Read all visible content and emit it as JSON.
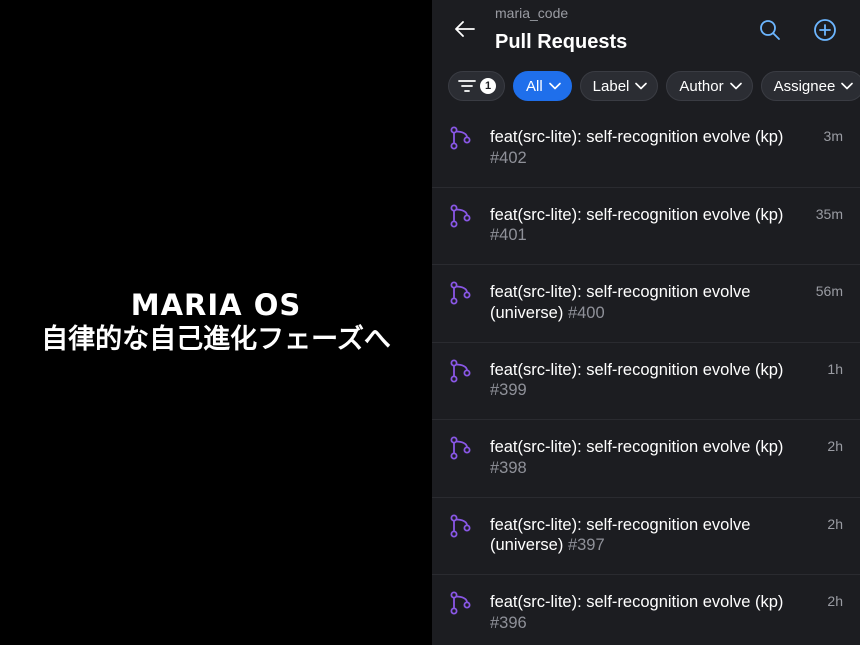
{
  "promo": {
    "title": "MARIA OS",
    "subtitle": "自律的な自己進化フェーズへ"
  },
  "header": {
    "repo": "maria_code",
    "title": "Pull Requests",
    "icons": [
      "arrow-left-icon",
      "search-icon",
      "plus-circle-icon"
    ]
  },
  "filters": {
    "filter_count": "1",
    "chips": [
      {
        "label": "All",
        "active": true
      },
      {
        "label": "Label",
        "active": false
      },
      {
        "label": "Author",
        "active": false
      },
      {
        "label": "Assignee",
        "active": false
      }
    ]
  },
  "colors": {
    "accent": "#1f6feb",
    "pr_icon": "#8957e5",
    "background": "#1c1d21"
  },
  "pull_requests": [
    {
      "title": "feat(src-lite): self-recognition evolve (kp)",
      "number": "#402",
      "time": "3m"
    },
    {
      "title": "feat(src-lite): self-recognition evolve (kp)",
      "number": "#401",
      "time": "35m"
    },
    {
      "title": "feat(src-lite): self-recognition evolve (universe)",
      "number": "#400",
      "time": "56m"
    },
    {
      "title": "feat(src-lite): self-recognition evolve (kp)",
      "number": "#399",
      "time": "1h"
    },
    {
      "title": "feat(src-lite): self-recognition evolve (kp)",
      "number": "#398",
      "time": "2h"
    },
    {
      "title": "feat(src-lite): self-recognition evolve (universe)",
      "number": "#397",
      "time": "2h"
    },
    {
      "title": "feat(src-lite): self-recognition evolve (kp)",
      "number": "#396",
      "time": "2h"
    }
  ]
}
